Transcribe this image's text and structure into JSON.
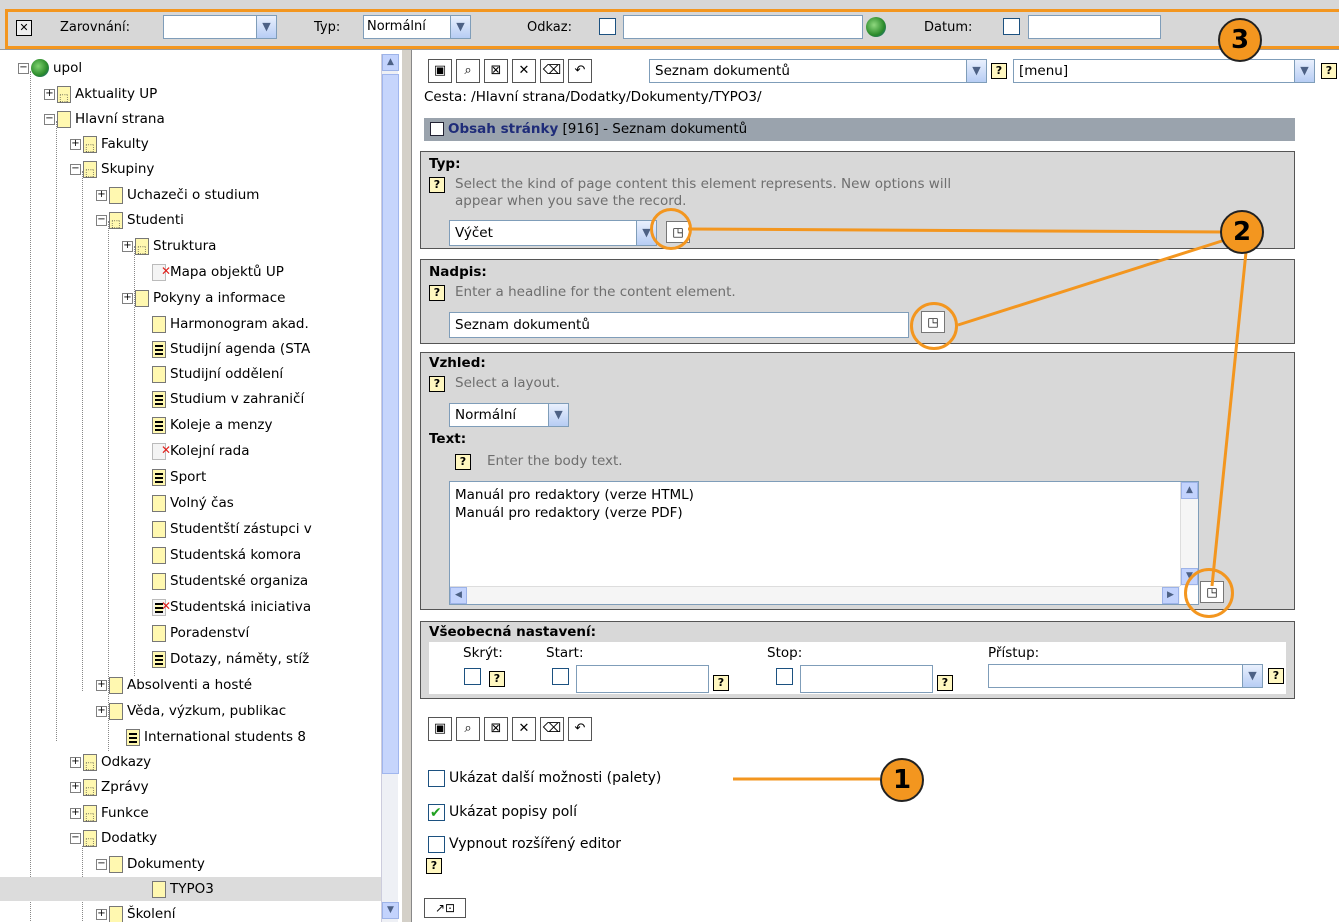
{
  "palette": {
    "close_glyph": "✕",
    "align_label": "Zarovnání:",
    "align_value": "",
    "type_label": "Typ:",
    "type_value": "Normální",
    "link_label": "Odkaz:",
    "link_value": "",
    "date_label": "Datum:",
    "date_value": ""
  },
  "tree": {
    "items": [
      {
        "label": "upol"
      },
      {
        "label": "Aktuality UP"
      },
      {
        "label": "Hlavní strana"
      },
      {
        "label": "Fakulty"
      },
      {
        "label": "Skupiny"
      },
      {
        "label": "Uchazeči o studium"
      },
      {
        "label": "Studenti"
      },
      {
        "label": "Struktura"
      },
      {
        "label": "Mapa objektů UP"
      },
      {
        "label": "Pokyny a informace"
      },
      {
        "label": "Harmonogram akad."
      },
      {
        "label": "Studijní agenda (STA"
      },
      {
        "label": "Studijní oddělení"
      },
      {
        "label": "Studium v zahraničí"
      },
      {
        "label": "Koleje a menzy"
      },
      {
        "label": "Kolejní rada"
      },
      {
        "label": "Sport"
      },
      {
        "label": "Volný čas"
      },
      {
        "label": "Studentští zástupci v"
      },
      {
        "label": "Studentská komora"
      },
      {
        "label": "Studentské organiza"
      },
      {
        "label": "Studentská iniciativa"
      },
      {
        "label": "Poradenství"
      },
      {
        "label": "Dotazy, náměty, stíž"
      },
      {
        "label": "Absolventi a hosté"
      },
      {
        "label": "Věda, výzkum, publikac"
      },
      {
        "label": "International students 8"
      },
      {
        "label": "Odkazy"
      },
      {
        "label": "Zprávy"
      },
      {
        "label": "Funkce"
      },
      {
        "label": "Dodatky"
      },
      {
        "label": "Dokumenty"
      },
      {
        "label": "TYPO3"
      },
      {
        "label": "Školení"
      }
    ]
  },
  "content": {
    "doc_select": "Seznam dokumentů",
    "menu_select": "[menu]",
    "path": "Cesta: /Hlavní strana/Dodatky/Dokumenty/TYPO3/",
    "panel_title_label": "Obsah stránky",
    "panel_title_rest": " [916] - Seznam dokumentů",
    "type_title": "Typ:",
    "type_desc_1": "Select the kind of page content this element represents. New options will",
    "type_desc_2": "appear when you save the record.",
    "type_value": "Výčet",
    "header_title": "Nadpis:",
    "header_desc": "Enter a headline for the content element.",
    "header_value": "Seznam dokumentů",
    "layout_title": "Vzhled:",
    "layout_desc": "Select a layout.",
    "layout_value": "Normální",
    "text_title": "Text:",
    "text_desc": "Enter the body text.",
    "text_line_1": "Manuál pro redaktory (verze HTML)",
    "text_line_2": "Manuál pro redaktory (verze PDF)",
    "general_title": "Všeobecná nastavení:",
    "hide_label": "Skrýt:",
    "start_label": "Start:",
    "stop_label": "Stop:",
    "access_label": "Přístup:",
    "opt_palettes": "Ukázat další možnosti (palety)",
    "opt_descriptions": "Ukázat popisy polí",
    "opt_rte": "Vypnout rozšířený editor"
  },
  "annotations": {
    "badge_1": "1",
    "badge_2": "2",
    "badge_3": "3"
  },
  "colors": {
    "accent": "#f3961f",
    "panel_title_bg": "#9aa3ad",
    "section_bg": "#d8d8d8"
  }
}
